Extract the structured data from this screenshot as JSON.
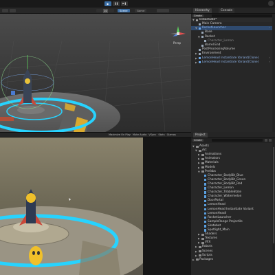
{
  "toolbar": {
    "play": "▶",
    "pause": "❚❚",
    "step": "▶❚"
  },
  "scene_header": {
    "btn_2d": "2D",
    "tab_scene": "Scene",
    "tab_game": "Game"
  },
  "scene_gizmo": {
    "label": "Persp",
    "x": "x",
    "y": "y",
    "z": "z"
  },
  "game_header": {
    "items": [
      "Maximize On Play",
      "Mute Audio",
      "VSync",
      "Stats",
      "Gizmos"
    ]
  },
  "hierarchy": {
    "tabs": [
      "Hierarchy",
      "Console"
    ],
    "create_label": "Create",
    "scene_name": "Instantiate*",
    "items": [
      {
        "label": "Main Camera",
        "indent": 1,
        "type": "go"
      },
      {
        "label": "RocketLauncher",
        "indent": 1,
        "type": "prefab",
        "expanded": true,
        "selected": true
      },
      {
        "label": "Base",
        "indent": 2,
        "type": "go"
      },
      {
        "label": "Rocket",
        "indent": 2,
        "type": "go",
        "expanded": true
      },
      {
        "label": "Character_Lemon",
        "indent": 3,
        "type": "go",
        "dim": true
      },
      {
        "label": "Barrel End",
        "indent": 2,
        "type": "go"
      },
      {
        "label": "PostProcessingVolume",
        "indent": 1,
        "type": "go"
      },
      {
        "label": "Environment",
        "indent": 1,
        "type": "go",
        "collapsed": true
      },
      {
        "label": "LemonHead Instantiate Variant(Clone)",
        "indent": 1,
        "type": "prefab",
        "collapsed": true
      },
      {
        "label": "LemonHead Instantiate Variant(Clone)",
        "indent": 1,
        "type": "prefab",
        "collapsed": true
      }
    ]
  },
  "project": {
    "tabs": [
      "Project"
    ],
    "create_label": "Create",
    "items": [
      {
        "label": "Assets",
        "indent": 0,
        "type": "folder",
        "expanded": true
      },
      {
        "label": "Art",
        "indent": 1,
        "type": "folder",
        "expanded": true
      },
      {
        "label": "Animations",
        "indent": 2,
        "type": "folder",
        "collapsed": true
      },
      {
        "label": "Animators",
        "indent": 2,
        "type": "folder",
        "collapsed": true
      },
      {
        "label": "Materials",
        "indent": 2,
        "type": "folder",
        "collapsed": true
      },
      {
        "label": "Models",
        "indent": 2,
        "type": "folder",
        "collapsed": true
      },
      {
        "label": "Prefabs",
        "indent": 2,
        "type": "folder",
        "expanded": true
      },
      {
        "label": "Character_BodyBit_Blue",
        "indent": 3,
        "type": "asset"
      },
      {
        "label": "Character_BodyBit_Green",
        "indent": 3,
        "type": "asset"
      },
      {
        "label": "Character_BodyBit_Red",
        "indent": 3,
        "type": "asset"
      },
      {
        "label": "Character_Lemon",
        "indent": 3,
        "type": "asset"
      },
      {
        "label": "Character_TribbleState",
        "indent": 3,
        "type": "asset"
      },
      {
        "label": "Character_Watermelon",
        "indent": 3,
        "type": "asset"
      },
      {
        "label": "DoorPortal",
        "indent": 3,
        "type": "asset"
      },
      {
        "label": "LemonHead",
        "indent": 3,
        "type": "asset"
      },
      {
        "label": "LemonHead Instantiate Variant",
        "indent": 3,
        "type": "asset"
      },
      {
        "label": "LemonHeadI",
        "indent": 3,
        "type": "asset"
      },
      {
        "label": "RocketLauncher",
        "indent": 3,
        "type": "asset"
      },
      {
        "label": "SampleRange Projectile",
        "indent": 3,
        "type": "asset"
      },
      {
        "label": "Skatebot",
        "indent": 3,
        "type": "asset"
      },
      {
        "label": "Spotlight_Main",
        "indent": 3,
        "type": "asset"
      },
      {
        "label": "Shaders",
        "indent": 2,
        "type": "folder",
        "collapsed": true
      },
      {
        "label": "Textures",
        "indent": 2,
        "type": "folder",
        "collapsed": true
      },
      {
        "label": "VFX",
        "indent": 2,
        "type": "folder",
        "collapsed": true
      },
      {
        "label": "Robots",
        "indent": 1,
        "type": "folder",
        "collapsed": true
      },
      {
        "label": "Scenes",
        "indent": 1,
        "type": "folder",
        "collapsed": true
      },
      {
        "label": "Scripts",
        "indent": 1,
        "type": "folder",
        "collapsed": true
      },
      {
        "label": "Packages",
        "indent": 0,
        "type": "folder",
        "collapsed": true
      }
    ]
  },
  "colors": {
    "accent": "#3b6ea5",
    "selection": "#2f4a6e",
    "glow": "#27d3ff",
    "stripe": "#e8b22a",
    "prefab_text": "#8fb4e8"
  }
}
